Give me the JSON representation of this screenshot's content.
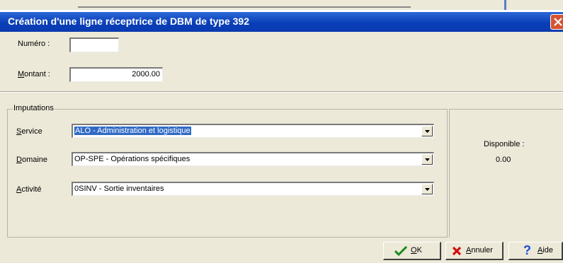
{
  "dialog": {
    "title": "Création d'une ligne réceptrice de DBM de type 392"
  },
  "form": {
    "numero": {
      "label": "Numéro :",
      "value": ""
    },
    "montant": {
      "label_ul": "M",
      "label_rest": "ontant :",
      "value": "2000.00"
    }
  },
  "imputations": {
    "legend": "Imputations",
    "service": {
      "label_ul": "S",
      "label_rest": "ervice",
      "value": "ALO - Administration et logistique"
    },
    "domaine": {
      "label_ul": "D",
      "label_rest": "omaine",
      "value": "OP-SPE - Opérations spécifiques"
    },
    "activite": {
      "label_ul": "A",
      "label_rest": "ctivité",
      "value": "0SINV - Sortie inventaires"
    }
  },
  "disponible": {
    "label": "Disponible :",
    "value": "0.00"
  },
  "buttons": {
    "ok": {
      "label_ul": "O",
      "label_rest": "K",
      "icon": "checkmark-icon",
      "color": "#1c8a1c"
    },
    "cancel": {
      "label_ul": "A",
      "label_rest": "nnuler",
      "icon": "red-x-icon",
      "color": "#d01010"
    },
    "help": {
      "label_ul": "A",
      "label_rest": "ide",
      "icon": "question-mark-icon",
      "color": "#1a4ed6"
    }
  }
}
